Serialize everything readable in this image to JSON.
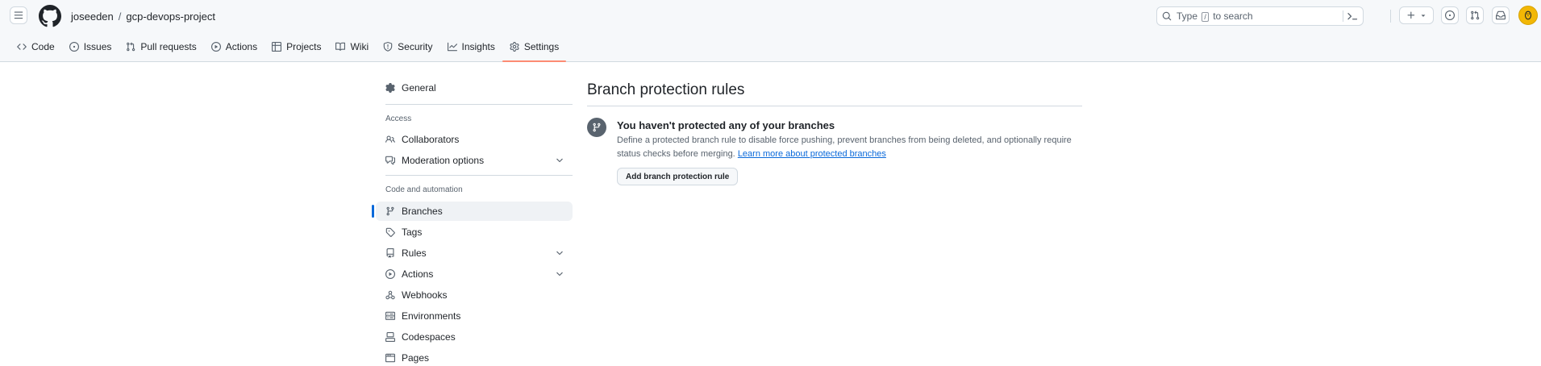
{
  "header": {
    "owner": "joseeden",
    "separator": "/",
    "repo": "gcp-devops-project",
    "search_prefix": "Type",
    "search_key": "/",
    "search_suffix": "to search"
  },
  "repo_nav": {
    "items": [
      {
        "label": "Code",
        "icon": "code-icon"
      },
      {
        "label": "Issues",
        "icon": "issue-opened-icon"
      },
      {
        "label": "Pull requests",
        "icon": "git-pull-request-icon"
      },
      {
        "label": "Actions",
        "icon": "play-icon"
      },
      {
        "label": "Projects",
        "icon": "table-icon"
      },
      {
        "label": "Wiki",
        "icon": "book-icon"
      },
      {
        "label": "Security",
        "icon": "shield-icon"
      },
      {
        "label": "Insights",
        "icon": "graph-icon"
      },
      {
        "label": "Settings",
        "icon": "gear-icon",
        "active": true
      }
    ]
  },
  "sidebar": {
    "general": "General",
    "access_heading": "Access",
    "collaborators": "Collaborators",
    "moderation": "Moderation options",
    "code_heading": "Code and automation",
    "branches": "Branches",
    "tags": "Tags",
    "rules": "Rules",
    "actions": "Actions",
    "webhooks": "Webhooks",
    "environments": "Environments",
    "codespaces": "Codespaces",
    "pages": "Pages"
  },
  "main": {
    "title": "Branch protection rules",
    "blank_title": "You haven't protected any of your branches",
    "blank_desc": "Define a protected branch rule to disable force pushing, prevent branches from being deleted, and optionally require status checks before merging.",
    "learn_more": "Learn more about protected branches",
    "add_button": "Add branch protection rule"
  },
  "colors": {
    "accent": "#0969da",
    "active_tab_underline": "#fd8c73",
    "avatar": "#f2b705"
  }
}
